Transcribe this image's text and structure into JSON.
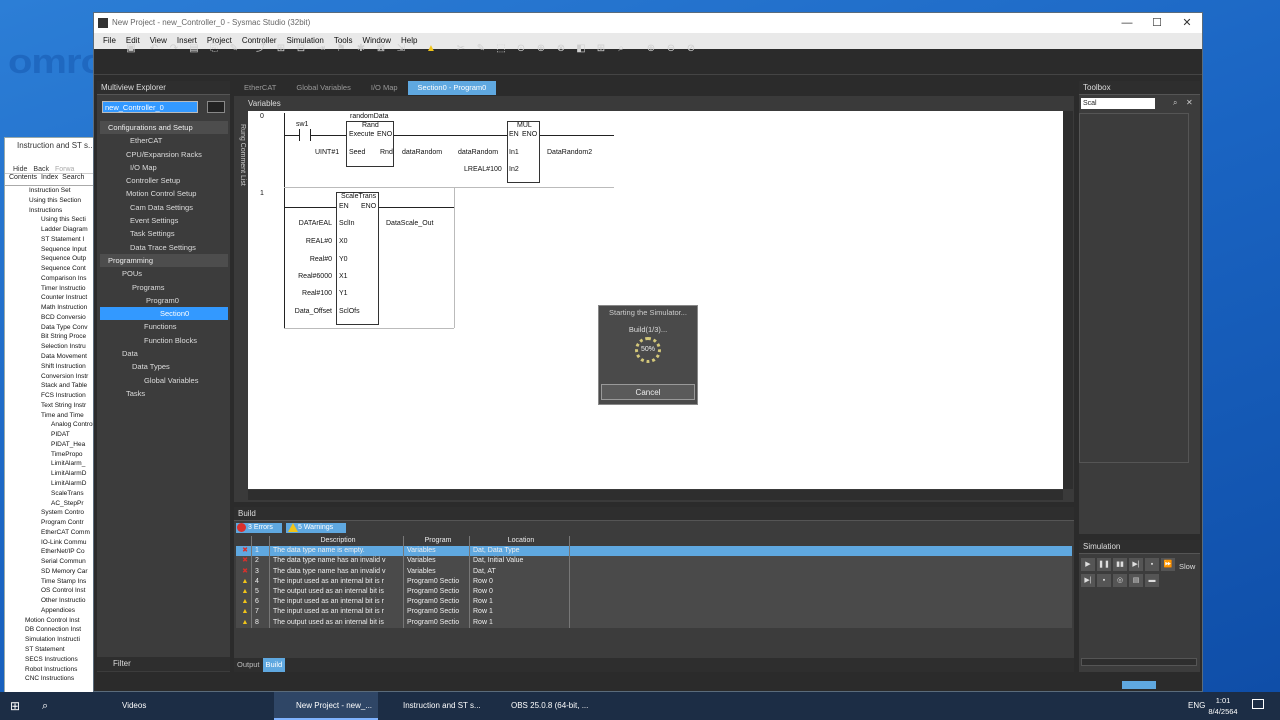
{
  "window": {
    "title": "New Project - new_Controller_0 - Sysmac Studio (32bit)",
    "min": "—",
    "max": "☐",
    "close": "✕"
  },
  "menu": [
    "File",
    "Edit",
    "View",
    "Insert",
    "Project",
    "Controller",
    "Simulation",
    "Tools",
    "Window",
    "Help"
  ],
  "brand": "omron",
  "help": {
    "title": "Instruction and ST s...",
    "toolbar": [
      "Hide",
      "Back",
      "Forwa"
    ],
    "tabs": [
      "Contents",
      "Index",
      "Search"
    ],
    "items": [
      "Instruction Set",
      "Using this Section",
      "Instructions",
      "Using this Secti",
      "Ladder Diagram",
      "ST Statement I",
      "Sequence Input",
      "Sequence Outp",
      "Sequence Cont",
      "Comparison Ins",
      "Timer Instructio",
      "Counter Instruct",
      "Math Instruction",
      "BCD Conversio",
      "Data Type Conv",
      "Bit String Proce",
      "Selection Instru",
      "Data Movement",
      "Shift Instruction",
      "Conversion Instr",
      "Stack and Table",
      "FCS Instruction",
      "Text String Instr",
      "Time and Time",
      "Analog Control",
      "PIDAT",
      "PIDAT_Hea",
      "TimePropo",
      "LimitAlarm_",
      "LimitAlarmD",
      "LimitAlarmD",
      "ScaleTrans",
      "AC_StepPr",
      "System Contro",
      "Program Contr",
      "EtherCAT Comm",
      "IO-Link Commu",
      "EtherNet/IP Co",
      "Serial Commun",
      "SD Memory Car",
      "Time Stamp Ins",
      "OS Control Inst",
      "Other Instructio",
      "Appendices",
      "Motion Control Inst",
      "DB Connection Inst",
      "Simulation Instructi",
      "ST Statement",
      "SECS Instructions",
      "Robot Instructions",
      "CNC Instructions"
    ]
  },
  "explorer": {
    "title": "Multiview Explorer",
    "controller": "new_Controller_0",
    "config_header": "Configurations and Setup",
    "config": [
      "EtherCAT",
      "CPU/Expansion Racks",
      "I/O Map",
      "Controller Setup",
      "Motion Control Setup",
      "Cam Data Settings",
      "Event Settings",
      "Task Settings",
      "Data Trace Settings"
    ],
    "prog_header": "Programming",
    "prog": [
      "POUs",
      "Programs",
      "Program0",
      "Section0",
      "Functions",
      "Function Blocks",
      "Data",
      "Data Types",
      "Global Variables",
      "Tasks"
    ],
    "filter": "Filter"
  },
  "tabs": [
    "EtherCAT",
    "Global Variables",
    "I/O Map",
    "Section0 - Program0"
  ],
  "editor": {
    "variables": "Variables",
    "side": "Rung Comment List",
    "rung0": {
      "num": "0",
      "contact": "sw1",
      "fb_inst": "randomData",
      "fb": "Rand",
      "execute": "Execute",
      "eno": "ENO",
      "seed": "Seed",
      "rnd": "Rnd",
      "seed_in": "UINT#1",
      "rnd_out": "dataRandom",
      "mul": "MUL",
      "en": "EN",
      "in1": "In1",
      "in2": "In2",
      "in1_val": "dataRandom",
      "in2_val": "LREAL#100",
      "mul_out": "DataRandom2"
    },
    "rung1": {
      "num": "1",
      "fb": "ScaleTrans",
      "en": "EN",
      "eno": "ENO",
      "pins": [
        "SclIn",
        "X0",
        "Y0",
        "X1",
        "Y1",
        "SclOfs"
      ],
      "inputs": [
        "DATArEAL",
        "REAL#0",
        "Real#0",
        "Real#6000",
        "Real#100",
        "Data_Offset"
      ],
      "out": "DataScale_Out"
    }
  },
  "dialog": {
    "title": "Starting the Simulator...",
    "status": "Build(1/3)...",
    "progress": "50%",
    "cancel": "Cancel"
  },
  "toolbox": {
    "title": "Toolbox",
    "search": "Scal"
  },
  "build": {
    "title": "Build",
    "errors": "3 Errors",
    "warnings": "5 Warnings",
    "cols": [
      "",
      "",
      "Description",
      "Program",
      "Location"
    ],
    "rows": [
      {
        "n": "1",
        "desc": "The data type name is empty.",
        "prog": "Variables",
        "loc": "Dat, Data Type",
        "type": "err"
      },
      {
        "n": "2",
        "desc": "The data type name has an invalid v",
        "prog": "Variables",
        "loc": "Dat, Initial Value",
        "type": "err"
      },
      {
        "n": "3",
        "desc": "The data type name has an invalid v",
        "prog": "Variables",
        "loc": "Dat, AT",
        "type": "err"
      },
      {
        "n": "4",
        "desc": "The input used as an internal bit is r",
        "prog": "Program0 Sectio",
        "loc": "Row 0",
        "type": "warn"
      },
      {
        "n": "5",
        "desc": "The output used as an internal bit is",
        "prog": "Program0 Sectio",
        "loc": "Row 0",
        "type": "warn"
      },
      {
        "n": "6",
        "desc": "The input used as an internal bit is r",
        "prog": "Program0 Sectio",
        "loc": "Row 1",
        "type": "warn"
      },
      {
        "n": "7",
        "desc": "The input used as an internal bit is r",
        "prog": "Program0 Sectio",
        "loc": "Row 1",
        "type": "warn"
      },
      {
        "n": "8",
        "desc": "The output used as an internal bit is",
        "prog": "Program0 Sectio",
        "loc": "Row 1",
        "type": "warn"
      }
    ],
    "tabs": [
      "Output",
      "Build"
    ]
  },
  "simulation": {
    "title": "Simulation",
    "speed": "Slow"
  },
  "taskbar": {
    "apps": [
      "Videos",
      "New Project - new_...",
      "Instruction and ST s...",
      "OBS 25.0.8 (64-bit, ..."
    ],
    "lang": "ENG",
    "time": "1:01",
    "date": "8/4/2564"
  },
  "colors": {
    "accent": "#3399ff",
    "error": "#d9302c",
    "warning": "#f0c419",
    "panel": "#3c3c3c"
  }
}
